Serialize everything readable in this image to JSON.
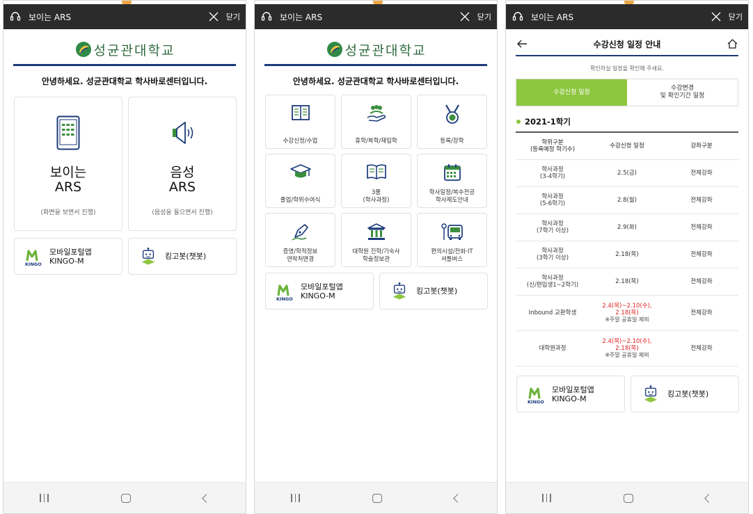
{
  "app": {
    "title": "보이는 ARS",
    "close_label": "닫기",
    "logo_text": "성균관대학교",
    "greeting": "안녕하세요. 성균관대학교 학사바로센터입니다."
  },
  "colors": {
    "top_bar": "#2b2b2b",
    "rule_blue": "#1b3a7a",
    "accent_green": "#8dc63f",
    "deadline_red": "#e02020"
  },
  "screen1": {
    "visible_ars": {
      "title": "보이는\nARS",
      "sub": "(화면을 보면서 진행)",
      "icon": "tablet-icon"
    },
    "voice_ars": {
      "title": "음성\nARS",
      "sub": "(음성을 들으면서 진행)",
      "icon": "speaker-icon"
    }
  },
  "shared": {
    "portal": {
      "label_line1": "모바일포털앱",
      "label_line2": "KINGO-M",
      "icon": "kingo-m-logo"
    },
    "chatbot": {
      "label": "킹고봇(챗봇)",
      "icon": "robot-icon"
    }
  },
  "screen2": {
    "menu": [
      {
        "label": "수강신청/수업",
        "icon": "book-icon"
      },
      {
        "label": "휴학/복학/재입학",
        "icon": "people-hand-icon"
      },
      {
        "label": "등록/장학",
        "icon": "medal-icon"
      },
      {
        "label": "졸업/학위수여식",
        "icon": "graduation-cap-icon"
      },
      {
        "label": "3품\n(학사과정)",
        "icon": "open-book-icon"
      },
      {
        "label": "학사일정/복수전공\n학사제도안내",
        "icon": "calendar-icon"
      },
      {
        "label": "증명/학적정보\n연락처변경",
        "icon": "pen-icon"
      },
      {
        "label": "대학원 진학/기숙사\n학술정보관",
        "icon": "building-icon"
      },
      {
        "label": "편의시설/전화·IT\n셔틀버스",
        "icon": "bus-icon"
      }
    ]
  },
  "screen3": {
    "title": "수강신청 일정 안내",
    "hint": "확인하실 일정을 확인해 주세요.",
    "tabs": [
      {
        "label": "수강신청 일정",
        "active": true
      },
      {
        "label": "수강변경\n및 확인기간 일정",
        "active": false
      }
    ],
    "semester": "2021-1학기",
    "table": {
      "headers": [
        "학위구분\n(등록예정 학기수)",
        "수강신청 일정",
        "강좌구분"
      ],
      "rows": [
        {
          "type": "학사과정\n(3-4학기)",
          "date": "2.5(금)",
          "date_red": false,
          "note": "",
          "kind": "전체강좌"
        },
        {
          "type": "학사과정\n(5-6학기)",
          "date": "2.8(월)",
          "date_red": false,
          "note": "",
          "kind": "전체강좌"
        },
        {
          "type": "학사과정\n(7학기 이상)",
          "date": "2.9(화)",
          "date_red": false,
          "note": "",
          "kind": "전체강좌"
        },
        {
          "type": "학사과정\n(3학기 이상)",
          "date": "2.18(목)",
          "date_red": false,
          "note": "",
          "kind": "전체강좌"
        },
        {
          "type": "학사과정\n(신/편입생1~2학기)",
          "date": "2.18(목)",
          "date_red": false,
          "note": "",
          "kind": "전체강좌"
        },
        {
          "type": "Inbound 교환학생",
          "date": "2.4(목)~2.10(수),\n2.18(목)",
          "date_red": true,
          "note": "※주말 공휴일 제외",
          "kind": "전체강좌"
        },
        {
          "type": "대학원과정",
          "date": "2.4(목)~2.10(수),\n2.18(목)",
          "date_red": true,
          "note": "※주말 공휴일 제외",
          "kind": "전체강좌"
        }
      ]
    }
  }
}
